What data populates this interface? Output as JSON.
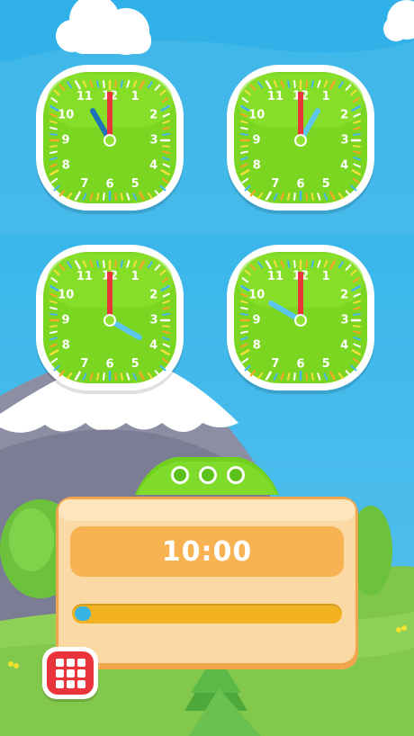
{
  "clocks": [
    {
      "id": "clock-1",
      "hour": 11,
      "minute": 0,
      "hour_hand_color": "#1e73b8",
      "minute_hand_color": "#e8343a"
    },
    {
      "id": "clock-2",
      "hour": 1,
      "minute": 0,
      "hour_hand_color": "#5dc6ef",
      "minute_hand_color": "#e8343a"
    },
    {
      "id": "clock-3",
      "hour": 4,
      "minute": 0,
      "hour_hand_color": "#5dc6ef",
      "minute_hand_color": "#e8343a"
    },
    {
      "id": "clock-4",
      "hour": 10,
      "minute": 0,
      "hour_hand_color": "#5dc6ef",
      "minute_hand_color": "#e8343a"
    }
  ],
  "clock_numerals": [
    "12",
    "1",
    "2",
    "3",
    "4",
    "5",
    "6",
    "7",
    "8",
    "9",
    "10",
    "11"
  ],
  "panel": {
    "indicator_dots": 3,
    "target_time": "10:00",
    "progress_fraction": 0.06
  },
  "menu_button": {
    "icon": "grid-menu-icon"
  },
  "colors": {
    "sky": "#3fb6ea",
    "clock_face": "#7ad620",
    "panel": "#fbd9a4",
    "panel_header": "#71cf1d",
    "menu_button": "#e8343a"
  }
}
